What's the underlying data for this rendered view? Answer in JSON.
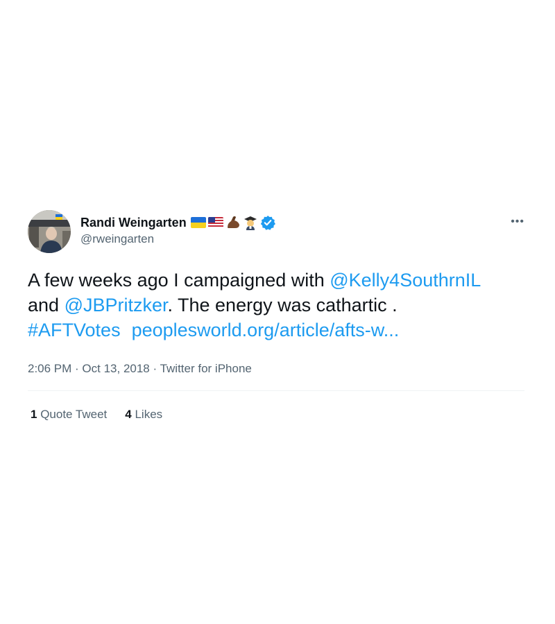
{
  "author": {
    "display_name": "Randi Weingarten",
    "handle": "@rweingarten",
    "badges": [
      "ukraine-flag",
      "us-flag",
      "flexed-biceps",
      "teacher",
      "verified"
    ]
  },
  "tweet": {
    "line1_text": "A few weeks ago I campaigned with ",
    "mention1": "@Kelly4SouthrnIL",
    "line2_prefix": "and ",
    "mention2": "@JBPritzker",
    "line2_suffix": ". The energy was cathartic .",
    "hashtag": "#AFTVotes",
    "url": "peoplesworld.org/article/afts-w..."
  },
  "meta": {
    "time": "2:06 PM",
    "sep1": " · ",
    "date": "Oct 13, 2018",
    "sep2": " · ",
    "source": "Twitter for iPhone"
  },
  "stats": {
    "quote_count": "1",
    "quote_label": " Quote Tweet",
    "like_count": "4",
    "like_label": " Likes"
  },
  "more_label": "•••",
  "colors": {
    "link": "#1d9bf0",
    "secondary_text": "#536471",
    "primary_text": "#0f1419",
    "verified": "#1d9bf0"
  }
}
